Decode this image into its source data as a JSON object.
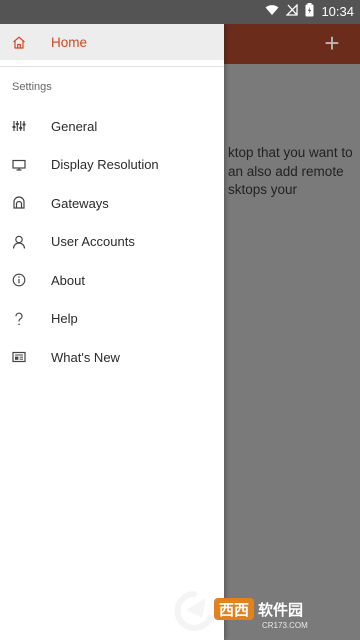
{
  "status": {
    "time": "10:34"
  },
  "drawer": {
    "home_label": "Home",
    "section_title": "Settings",
    "items": [
      {
        "label": "General",
        "icon": "sliders-icon"
      },
      {
        "label": "Display Resolution",
        "icon": "monitor-icon"
      },
      {
        "label": "Gateways",
        "icon": "gateway-icon"
      },
      {
        "label": "User Accounts",
        "icon": "person-icon"
      },
      {
        "label": "About",
        "icon": "info-icon"
      },
      {
        "label": "Help",
        "icon": "question-icon"
      },
      {
        "label": "What's New",
        "icon": "whats-new-icon"
      }
    ]
  },
  "background": {
    "text_lines": "ktop that you want to\nan also add remote\nsktops your"
  },
  "watermark": {
    "brand": "西西软件园",
    "domain": "CR173.COM"
  },
  "colors": {
    "accent": "#d24726"
  }
}
